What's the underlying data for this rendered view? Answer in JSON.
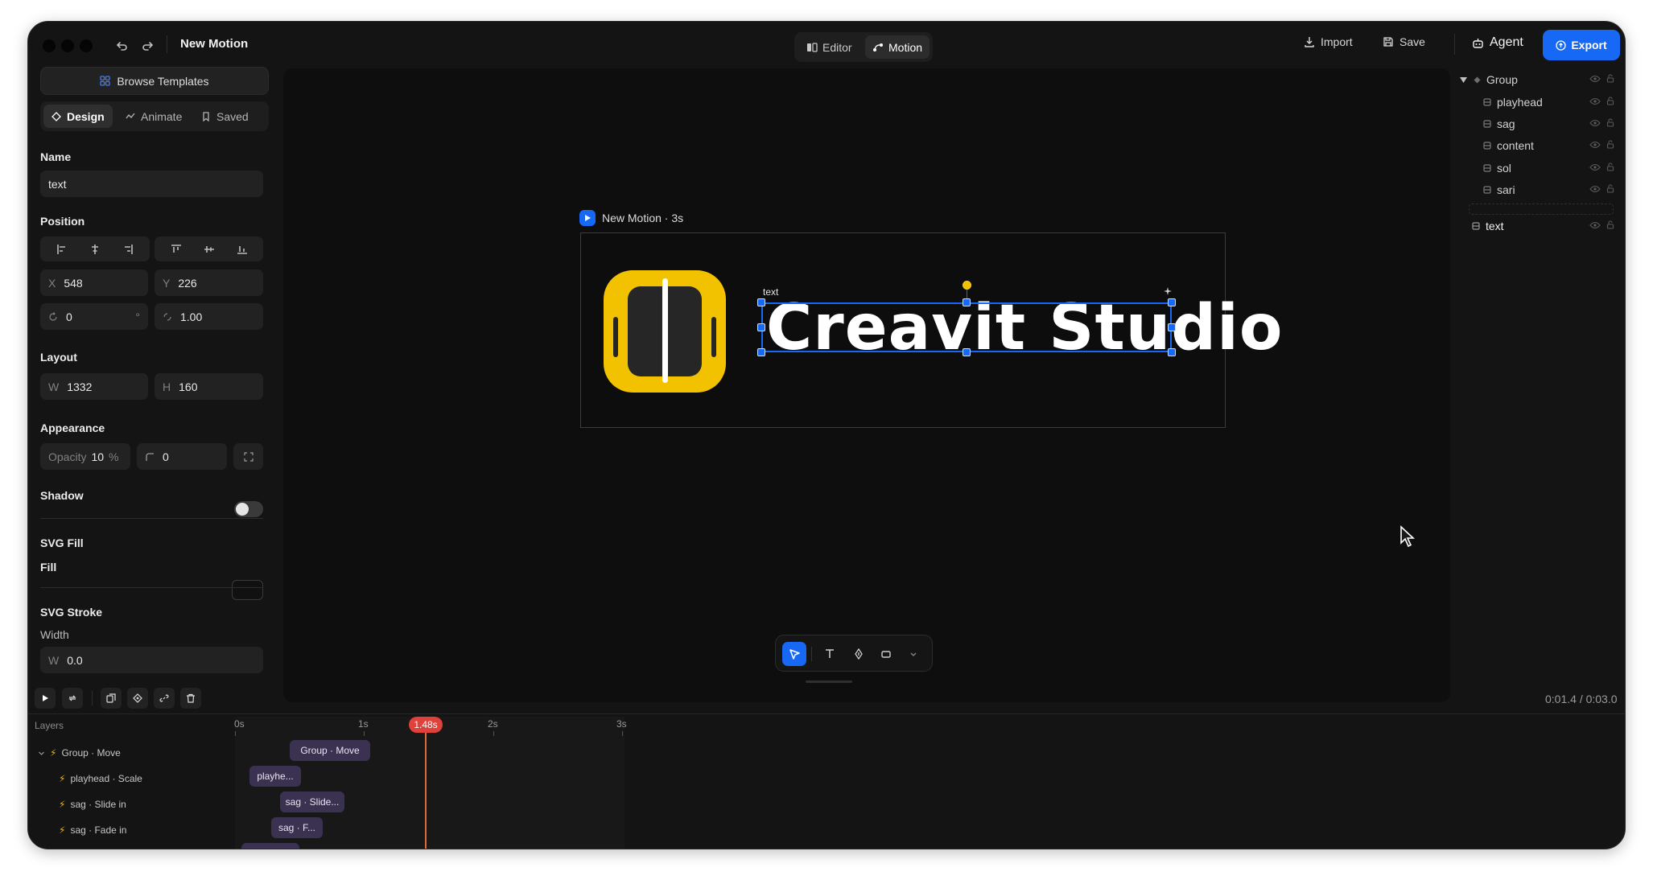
{
  "app": {
    "title": "New Motion",
    "mode_tabs": [
      {
        "label": "Editor",
        "active": false
      },
      {
        "label": "Motion",
        "active": true
      }
    ],
    "actions": {
      "import": "Import",
      "save": "Save",
      "agent": "Agent",
      "export": "Export"
    },
    "accent_color": "#1769f5"
  },
  "left_panel": {
    "browse_templates": "Browse Templates",
    "tabs": [
      {
        "label": "Design",
        "active": true
      },
      {
        "label": "Animate",
        "active": false
      },
      {
        "label": "Saved",
        "active": false
      }
    ],
    "name": {
      "label": "Name",
      "value": "text"
    },
    "position": {
      "label": "Position",
      "x_label": "X",
      "x": "548",
      "y_label": "Y",
      "y": "226",
      "rotation": "0",
      "rotation_unit": "°",
      "scale": "1.00"
    },
    "layout": {
      "label": "Layout",
      "w_label": "W",
      "w": "1332",
      "h_label": "H",
      "h": "160"
    },
    "appearance": {
      "label": "Appearance",
      "opacity_label": "Opacity",
      "opacity": "10",
      "opacity_unit": "%",
      "radius": "0"
    },
    "shadow": {
      "label": "Shadow",
      "enabled": false
    },
    "svg_fill": {
      "label": "SVG Fill",
      "fill_label": "Fill",
      "fill_color": "#111111"
    },
    "svg_stroke": {
      "label": "SVG Stroke",
      "width_label": "Width",
      "w_label": "W",
      "w": "0.0"
    }
  },
  "canvas": {
    "frame_label": "New Motion · 3s",
    "selection_label": "text",
    "text_content": "Creavit Studio",
    "logo_color": "#f2c200"
  },
  "right_panel": {
    "layers": [
      {
        "name": "Group",
        "level": 0,
        "type": "group"
      },
      {
        "name": "playhead",
        "level": 1
      },
      {
        "name": "sag",
        "level": 1
      },
      {
        "name": "content",
        "level": 1
      },
      {
        "name": "sol",
        "level": 1
      },
      {
        "name": "sari",
        "level": 1
      },
      {
        "name": "text",
        "level": 0
      }
    ]
  },
  "timeline": {
    "time_display": "0:01.4 / 0:03.0",
    "layers_header": "Layers",
    "ruler": [
      "0s",
      "1s",
      "2s",
      "3s"
    ],
    "playhead": "1.48s",
    "rows": [
      {
        "label": "Group · Move",
        "expanded": true
      },
      {
        "label": "playhead · Scale"
      },
      {
        "label": "sag · Slide in"
      },
      {
        "label": "sag · Fade in"
      }
    ],
    "clips": [
      {
        "label": "Group · Move"
      },
      {
        "label": "playhe..."
      },
      {
        "label": "sag · Slide..."
      },
      {
        "label": "sag · F..."
      }
    ]
  }
}
